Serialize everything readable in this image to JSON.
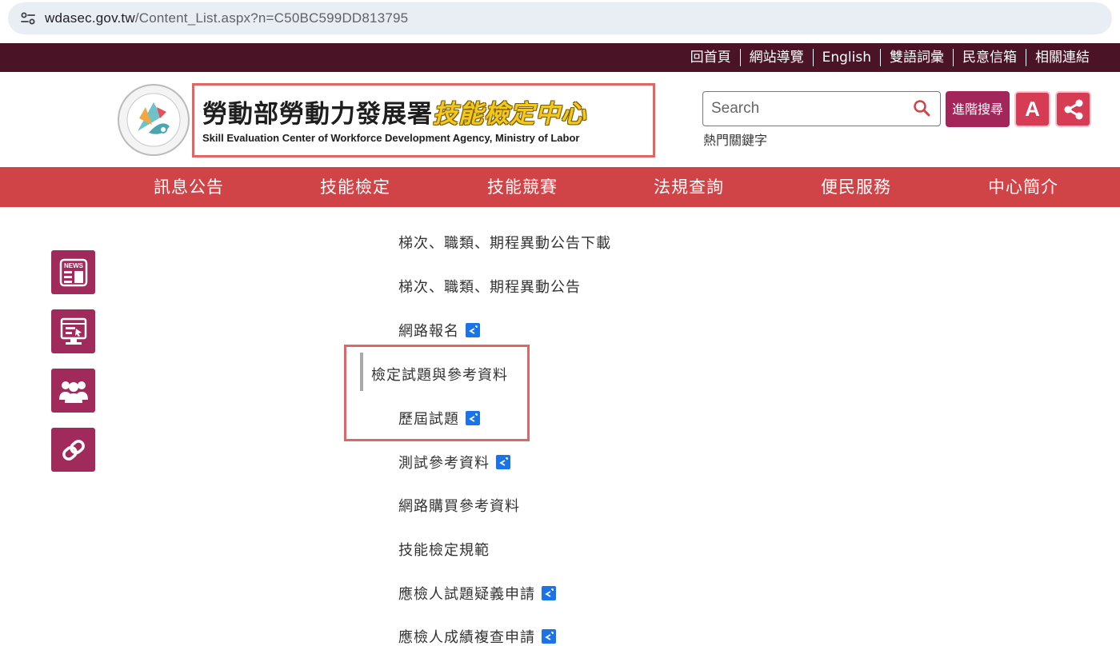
{
  "browser": {
    "url_host": "wdasec.gov.tw",
    "url_path": "/Content_List.aspx?n=C50BC599DD813795"
  },
  "top_links": [
    "回首頁",
    "網站導覽",
    "English",
    "雙語詞彙",
    "民意信箱",
    "相關連結"
  ],
  "header": {
    "logo_zh_main": "勞動部勞動力發展署",
    "logo_zh_accent": "技能檢定中心",
    "logo_en": "Skill Evaluation Center of Workforce Development Agency, Ministry of Labor",
    "search_placeholder": "Search",
    "hot_keywords_label": "熱門關鍵字",
    "advanced_search_label": "進階搜尋",
    "font_size_label": "A"
  },
  "main_nav": [
    "訊息公告",
    "技能檢定",
    "技能競賽",
    "法規查詢",
    "便民服務",
    "中心簡介"
  ],
  "side_icons": [
    "news-icon",
    "online-service-icon",
    "people-icon",
    "link-icon"
  ],
  "menu": {
    "items": [
      {
        "label": "梯次、職類、期程異動公告下載",
        "external": false
      },
      {
        "label": "梯次、職類、期程異動公告",
        "external": false
      },
      {
        "label": "網路報名",
        "external": true
      },
      {
        "label": "檢定試題與參考資料",
        "external": false,
        "active": true
      },
      {
        "label": "歷屆試題",
        "external": true
      },
      {
        "label": "測試參考資料",
        "external": true
      },
      {
        "label": "網路購買參考資料",
        "external": false
      },
      {
        "label": "技能檢定規範",
        "external": false
      },
      {
        "label": "應檢人試題疑義申請",
        "external": true
      },
      {
        "label": "應檢人成績複查申請",
        "external": true
      }
    ]
  },
  "colors": {
    "top_strip": "#4a1326",
    "main_nav": "#d04448",
    "side_icon_bg": "#a12a5c",
    "highlight": "#e06666",
    "adv_search_bg": "#a3265b",
    "round_btn_bg": "#d63d55"
  }
}
